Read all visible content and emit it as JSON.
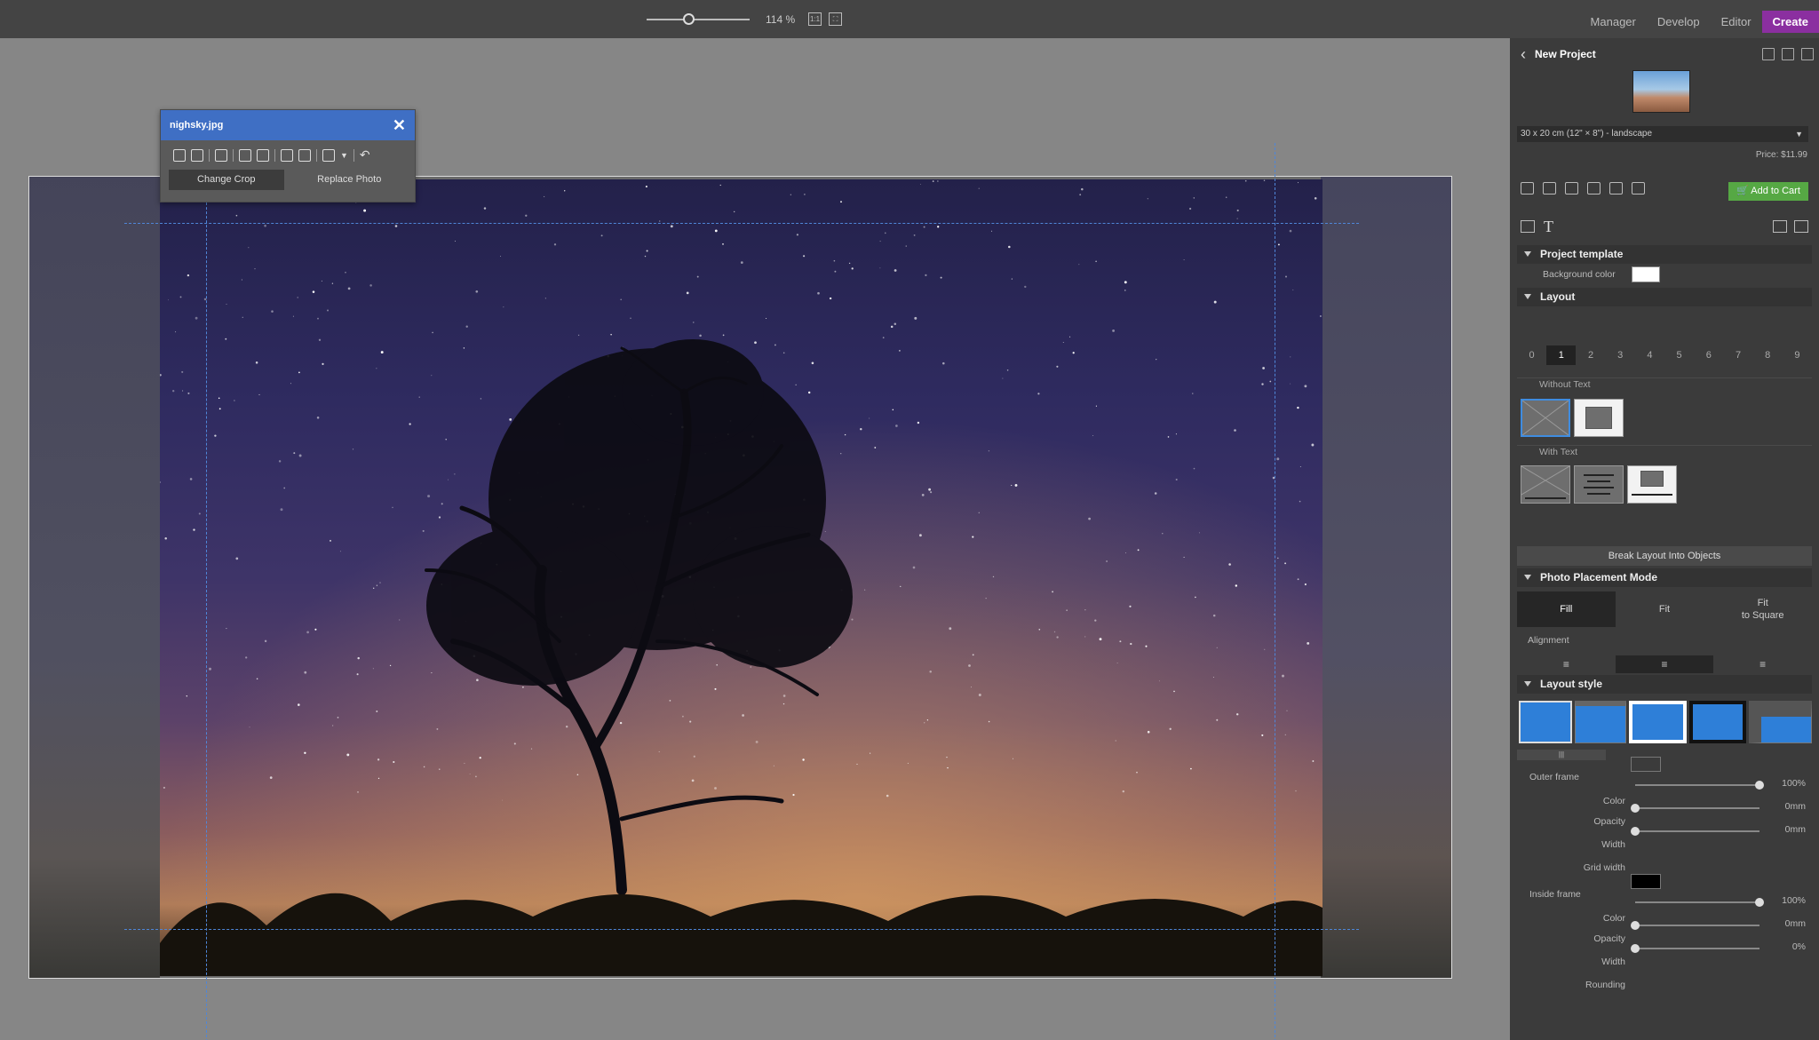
{
  "topbar": {
    "zoom": {
      "value": 32,
      "label": "114 %"
    },
    "modes": [
      {
        "label": "Manager",
        "active": false
      },
      {
        "label": "Develop",
        "active": false
      },
      {
        "label": "Editor",
        "active": false
      },
      {
        "label": "Create",
        "active": true
      }
    ]
  },
  "photo_panel": {
    "filename": "nighsky.jpg",
    "buttons": {
      "change_crop": "Change Crop",
      "replace_photo": "Replace Photo"
    }
  },
  "right_panel": {
    "title": "New Project",
    "size_option": "30 x 20 cm (12\" × 8\") - landscape",
    "price": "Price: $11.99",
    "add_to_cart": "Add to Cart",
    "project_template": {
      "heading": "Project template",
      "background_color_label": "Background color",
      "background_color": "#ffffff"
    },
    "layout": {
      "heading": "Layout",
      "tabs": [
        "0",
        "1",
        "2",
        "3",
        "4",
        "5",
        "6",
        "7",
        "8",
        "9"
      ],
      "selected_tab": "1",
      "without_text_label": "Without Text",
      "with_text_label": "With Text",
      "break_button": "Break Layout Into Objects"
    },
    "placement": {
      "heading": "Photo Placement Mode",
      "modes": [
        "Fill",
        "Fit",
        "Fit\nto Square"
      ],
      "selected": "Fill",
      "alignment_label": "Alignment"
    },
    "layout_style": {
      "heading": "Layout style",
      "accent": "#2e7fd8",
      "outer_frame": {
        "label": "Outer frame",
        "color_label": "Color",
        "color": "#3b3b3b",
        "opacity_label": "Opacity",
        "opacity": "100%",
        "opacity_value": 100,
        "width_label": "Width",
        "width": "0mm",
        "grid_width_label": "Grid width",
        "grid_width": "0mm"
      },
      "inside_frame": {
        "label": "Inside frame",
        "color_label": "Color",
        "color": "#000000",
        "opacity_label": "Opacity",
        "opacity": "100%",
        "opacity_value": 100,
        "width_label": "Width",
        "width": "0mm",
        "rounding_label": "Rounding",
        "rounding": "0%"
      }
    }
  }
}
